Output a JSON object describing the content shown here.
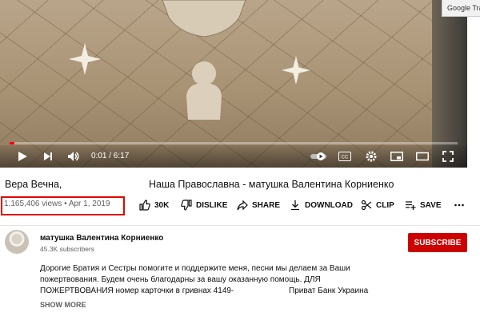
{
  "side_panel": {
    "label": "Google Trans"
  },
  "player": {
    "current_time": "0:01",
    "duration": "6:17",
    "time_text": "0:01 / 6:17",
    "progress_fraction": 0.003,
    "controls": [
      "play-icon",
      "next-icon",
      "volume-icon",
      "autoplay-toggle",
      "captions-icon",
      "settings-icon",
      "miniplayer-icon",
      "theater-icon",
      "fullscreen-icon"
    ],
    "captions_label": "CC"
  },
  "video": {
    "title_part1": "Вера Вечна,",
    "title_part2": "Наша Православна - матушка Валентина Корниенко",
    "views": "1,165,406 views",
    "separator": "•",
    "date": "Apr 1, 2019"
  },
  "actions": {
    "like": "30K",
    "dislike": "DISLIKE",
    "share": "SHARE",
    "download": "DOWNLOAD",
    "clip": "CLIP",
    "save": "SAVE"
  },
  "channel": {
    "name": "матушка Валентина Корниенко",
    "subscribers": "45.3K subscribers",
    "subscribe_label": "SUBSCRIBE"
  },
  "description": {
    "line1": "Дорогие Братия и Сестры помогите и поддержите меня, песни мы делаем за Ваши",
    "line2": "пожертвования. Будем очень благодарны за вашу оказанную помощь.  ДЛЯ",
    "line3_start": "ПОЖЕРТВОВАНИЯ номер карточки в гривнах 4149-",
    "line3_end": "Приват Банк Украина",
    "show_more": "SHOW MORE"
  },
  "colors": {
    "accent_red": "#cc0000",
    "progress_red": "#ff0000",
    "highlight_box": "#e10600"
  }
}
